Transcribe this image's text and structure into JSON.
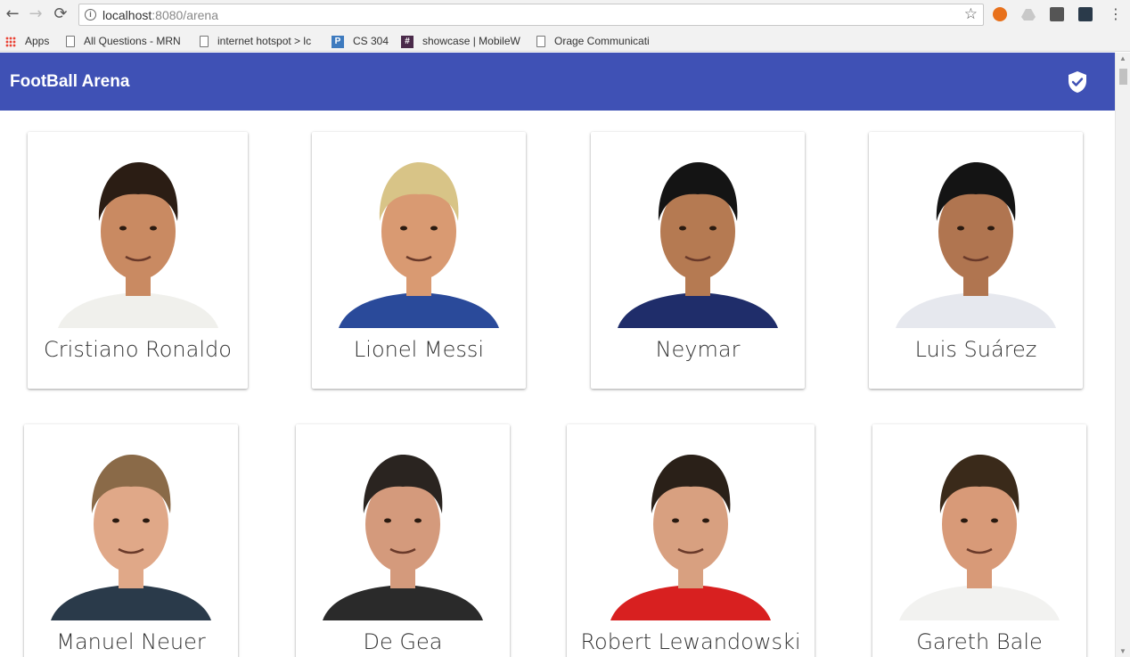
{
  "browser": {
    "url_host": "localhost",
    "url_rest": ":8080/arena",
    "bookmarks": [
      {
        "label": "Apps",
        "icon": "apps-grid-icon"
      },
      {
        "label": "All Questions - MRN",
        "icon": "page-icon"
      },
      {
        "label": "internet hotspot > lc",
        "icon": "page-icon"
      },
      {
        "label": "CS 304",
        "icon": "p-icon"
      },
      {
        "label": "showcase | MobileW",
        "icon": "hash-icon"
      },
      {
        "label": "Orage Communicati",
        "icon": "page-icon"
      }
    ]
  },
  "app": {
    "title": "FootBall Arena",
    "brand_color": "#3f51b5"
  },
  "players": [
    {
      "name": "Cristiano Ronaldo",
      "skin": "#c98a62",
      "hair": "#2b1d14",
      "shirt": "#f0f0ec"
    },
    {
      "name": "Lionel Messi",
      "skin": "#d99a72",
      "hair": "#d8c487",
      "shirt": "#2a4a9a"
    },
    {
      "name": "Neymar",
      "skin": "#b57a52",
      "hair": "#141414",
      "shirt": "#1f2d6a"
    },
    {
      "name": "Luis Suárez",
      "skin": "#b07550",
      "hair": "#141414",
      "shirt": "#e6e8ee"
    },
    {
      "name": "Manuel Neuer",
      "skin": "#e0a888",
      "hair": "#8a6a48",
      "shirt": "#2a3a4a"
    },
    {
      "name": "De Gea",
      "skin": "#d49a7c",
      "hair": "#2a2420",
      "shirt": "#2a2a2a"
    },
    {
      "name": "Robert Lewandowski",
      "skin": "#d8a080",
      "hair": "#2a2018",
      "shirt": "#d82020"
    },
    {
      "name": "Gareth Bale",
      "skin": "#d89a78",
      "hair": "#3a2a1a",
      "shirt": "#f2f2f0"
    }
  ]
}
